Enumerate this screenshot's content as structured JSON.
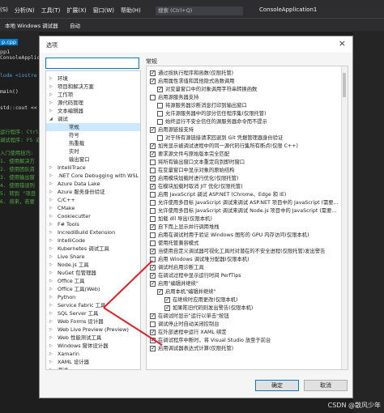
{
  "ide": {
    "menu": [
      "(S)",
      "分析(N)",
      "工具(T)",
      "扩展(X)",
      "窗口(W)",
      "帮助(H)"
    ],
    "search_placeholder": "搜索 (Ctrl+Q)",
    "app_title": "ConsoleApplication1",
    "machine": "本地 Windows 调试器",
    "config": "自动",
    "tab_active": "p.cpp",
    "tab_solution": "pp1",
    "code_lines": [
      {
        "text": "ConsoleApplic",
        "color": "white"
      },
      {
        "text": "lude <iostre",
        "color": "blue"
      },
      {
        "text": "main()",
        "color": "white"
      },
      {
        "text": "std::cout <<",
        "color": "white"
      },
      {
        "text": "运行程序: Ctrl",
        "color": "green"
      },
      {
        "text": "调试程序: F5 或",
        "color": "green"
      },
      {
        "text": "入门使用技巧:",
        "color": "green"
      },
      {
        "text": "1. 使用解决方",
        "color": "green"
      },
      {
        "text": "2. 使用团队资",
        "color": "green"
      },
      {
        "text": "3. 使用输出窗",
        "color": "green"
      },
      {
        "text": "4. 使用错误列",
        "color": "green"
      },
      {
        "text": "5. 转到 \"项目",
        "color": "green"
      },
      {
        "text": "6. 将来，若要",
        "color": "green"
      }
    ]
  },
  "dialog": {
    "title": "选项",
    "close": "×",
    "search_value": "",
    "section_title": "常规",
    "ok_label": "确定",
    "cancel_label": "取消"
  },
  "tree": [
    {
      "label": "环境",
      "level": 0,
      "expanded": false
    },
    {
      "label": "项目和解决方案",
      "level": 0,
      "expanded": false
    },
    {
      "label": "工作项",
      "level": 0,
      "expanded": false
    },
    {
      "label": "源代码管理",
      "level": 0,
      "expanded": false
    },
    {
      "label": "文本编辑器",
      "level": 0,
      "expanded": false
    },
    {
      "label": "调试",
      "level": 0,
      "expanded": true
    },
    {
      "label": "常规",
      "level": 1,
      "selected": true
    },
    {
      "label": "符号",
      "level": 1
    },
    {
      "label": "热重载",
      "level": 1
    },
    {
      "label": "实时",
      "level": 1
    },
    {
      "label": "输出窗口",
      "level": 1
    },
    {
      "label": "IntelliTrace",
      "level": 0,
      "expanded": false
    },
    {
      "label": ".NET Core Debugging with WSL",
      "level": 0,
      "expanded": false
    },
    {
      "label": "Azure Data Lake",
      "level": 0,
      "expanded": false
    },
    {
      "label": "Azure 服务身份验证",
      "level": 0,
      "expanded": false
    },
    {
      "label": "C/C++",
      "level": 0,
      "expanded": false
    },
    {
      "label": "CMake",
      "level": 0,
      "expanded": false
    },
    {
      "label": "Cookiecutter",
      "level": 0,
      "expanded": false
    },
    {
      "label": "F# Tools",
      "level": 0,
      "expanded": false
    },
    {
      "label": "IncrediBuild Extension",
      "level": 0,
      "expanded": false
    },
    {
      "label": "IntelliCode",
      "level": 0,
      "expanded": false
    },
    {
      "label": "Kubernetes 调试工具",
      "level": 0,
      "expanded": false
    },
    {
      "label": "Live Share",
      "level": 0,
      "expanded": false
    },
    {
      "label": "Node.js 工具",
      "level": 0,
      "expanded": false
    },
    {
      "label": "NuGet 包管理器",
      "level": 0,
      "expanded": false
    },
    {
      "label": "Office 工具",
      "level": 0,
      "expanded": false
    },
    {
      "label": "Office 工具(Web)",
      "level": 0,
      "expanded": false
    },
    {
      "label": "Python",
      "level": 0,
      "expanded": false
    },
    {
      "label": "Service Fabric 工具",
      "level": 0,
      "expanded": false
    },
    {
      "label": "SQL Server 工具",
      "level": 0,
      "expanded": false
    },
    {
      "label": "Web Forms 设计器",
      "level": 0,
      "expanded": false
    },
    {
      "label": "Web Live Preview (Preview)",
      "level": 0,
      "expanded": false
    },
    {
      "label": "Web 性能测试工具",
      "level": 0,
      "expanded": false
    },
    {
      "label": "Windows 窗体设计器",
      "level": 0,
      "expanded": false
    },
    {
      "label": "Xamarin",
      "level": 0,
      "expanded": false
    },
    {
      "label": "XAML 设计器",
      "level": 0,
      "expanded": false
    },
    {
      "label": "测试",
      "level": 0,
      "expanded": false
    }
  ],
  "options": [
    {
      "label": "通过按执行程序和函数(仅限托管)",
      "checked": true,
      "level": 0
    },
    {
      "label": "启用属性求值和其他隐式函数调用",
      "checked": true,
      "level": 0
    },
    {
      "label": "对变量窗口中的对象调用字符串转换函数",
      "checked": true,
      "level": 1
    },
    {
      "label": "启用源服务器支持",
      "checked": false,
      "level": 0
    },
    {
      "label": "将源服务器诊断消息打印到输出窗口",
      "checked": false,
      "level": 1
    },
    {
      "label": "允许源服务器中的部分信任程序集(仅限托管)",
      "checked": false,
      "level": 1
    },
    {
      "label": "始终运行不安全信任的源服务器命令而不提示",
      "checked": false,
      "level": 1
    },
    {
      "label": "启用源链接支持",
      "checked": true,
      "level": 0
    },
    {
      "label": "对于所有源链接请求回退到 Git 凭据管理器身份验证",
      "checked": false,
      "level": 1
    },
    {
      "label": "加亮显示被调试进程中的同一源代码行集所有断点(仅限 C++)",
      "checked": true,
      "level": 0
    },
    {
      "label": "要求源文件与原始版本完全匹配",
      "checked": true,
      "level": 0
    },
    {
      "label": "将所有输出窗口文本重定向到即时窗口",
      "checked": false,
      "level": 0
    },
    {
      "label": "在变量窗口中显示对象的原始结构",
      "checked": false,
      "level": 0
    },
    {
      "label": "启用模块加载时进行优化(仅限托管)",
      "checked": true,
      "level": 0
    },
    {
      "label": "在模块加载时取消 JIT 优化(仅限托管)",
      "checked": true,
      "level": 0
    },
    {
      "label": "启用 JavaScript 调试 ASP.NET (Chrome、Edge 和 IE)",
      "checked": false,
      "level": 0
    },
    {
      "label": "允许使用多目标 JavaScript 调试来调试 ASP.NET 项目中的 JavaScript (需要...",
      "checked": false,
      "level": 0
    },
    {
      "label": "允许使用多目标 JavaScript 调试来调试 Node.js 项目中的 JavaScript (需要...",
      "checked": false,
      "level": 0
    },
    {
      "label": "加载 dll 导出(仅限本机)",
      "checked": false,
      "level": 0
    },
    {
      "label": "自下而上显示并行调用堆栈",
      "checked": true,
      "level": 0
    },
    {
      "label": "启用在调试时用于验证 Windows 图形的 GPU 内存访问(仅限本机)",
      "checked": false,
      "level": 0
    },
    {
      "label": "使用托管兼容模式",
      "checked": false,
      "level": 0
    },
    {
      "label": "当使用自定义调试器可视化工具时对潜在的不安全进程(仅限托管)发出警告",
      "checked": true,
      "level": 0
    },
    {
      "label": "启用 Windows 调试堆分配器(仅限本机)",
      "checked": false,
      "level": 0
    },
    {
      "label": "调试时启用诊断工具",
      "checked": true,
      "level": 0
    },
    {
      "label": "在调试过程中显示运行时间 PerfTips",
      "checked": true,
      "level": 0
    },
    {
      "label": "启用\"编辑并继续\"",
      "checked": true,
      "level": 0
    },
    {
      "label": "启用本机\"编辑并继续\"",
      "checked": true,
      "level": 1
    },
    {
      "label": "在继续时应用更改(仅限本机)",
      "checked": true,
      "level": 2
    },
    {
      "label": "如果陈旧代码则发出警告(仅限本机)",
      "checked": true,
      "level": 2
    },
    {
      "label": "在调试时显示\"运行以单击\"按钮",
      "checked": true,
      "level": 0
    },
    {
      "label": "调试停止时自动关闭控制台",
      "checked": false,
      "level": 0
    },
    {
      "label": "在外部进程中运行 XAML 绑定",
      "checked": true,
      "level": 0
    },
    {
      "label": "在调试程序中断时，将 Visual Studio 放至于前台",
      "checked": true,
      "level": 0
    },
    {
      "label": "启用调试器表达式计算(仅限托管)",
      "checked": true,
      "level": 0
    }
  ],
  "watermark": "CSDN @散风少年",
  "annotation_color": "#e0202a"
}
